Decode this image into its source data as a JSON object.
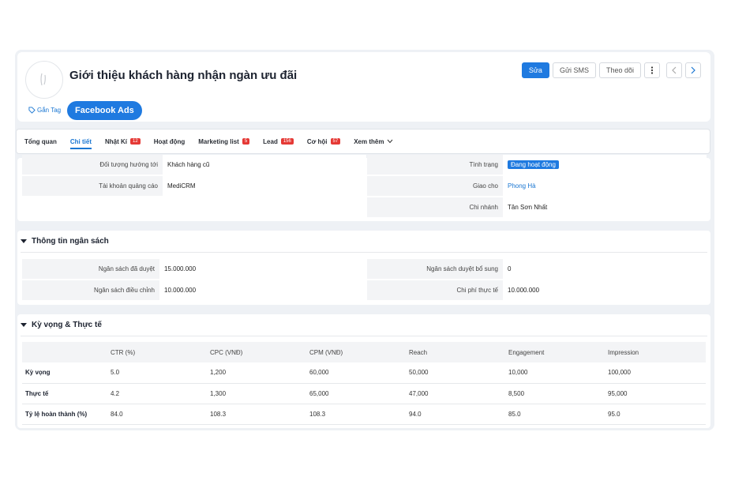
{
  "header": {
    "title": "Giới thiệu khách hàng nhận ngàn ưu đãi",
    "tag_label": "Gắn Tag",
    "channel_pill": "Facebook Ads",
    "actions": {
      "edit": "Sửa",
      "sms": "Gửi SMS",
      "follow": "Theo dõi"
    }
  },
  "tabs": [
    {
      "label": "Tổng quan"
    },
    {
      "label": "Chi tiết"
    },
    {
      "label": "Nhật Kí",
      "badge": "12"
    },
    {
      "label": "Hoạt động"
    },
    {
      "label": "Marketing list",
      "badge": "5"
    },
    {
      "label": "Lead",
      "badge": "156"
    },
    {
      "label": "Cơ hội",
      "badge": "57"
    },
    {
      "label": "Xem thêm"
    }
  ],
  "detail": {
    "left": [
      {
        "label": "Đối tượng hướng tới",
        "value": "Khách hàng cũ"
      },
      {
        "label": "Tài khoản quảng cáo",
        "value": "MediCRM"
      }
    ],
    "right": [
      {
        "label": "Tình trạng",
        "value": "Đang hoạt động"
      },
      {
        "label": "Giao cho",
        "value": "Phong Hà"
      },
      {
        "label": "Chi nhánh",
        "value": "Tân Sơn Nhất"
      }
    ]
  },
  "budget": {
    "title": "Thông tin ngân sách",
    "left": [
      {
        "label": "Ngân sách đã duyệt",
        "value": "15.000.000"
      },
      {
        "label": "Ngân sách điều chỉnh",
        "value": "10.000.000"
      }
    ],
    "right": [
      {
        "label": "Ngân sách duyệt bổ sung",
        "value": "0"
      },
      {
        "label": "Chi phí thực tế",
        "value": "10.000.000"
      }
    ]
  },
  "kpi": {
    "title": "Kỳ vọng & Thực tế",
    "columns": [
      "CTR (%)",
      "CPC (VNĐ)",
      "CPM (VNĐ)",
      "Reach",
      "Engagement",
      "Impression"
    ],
    "rows": [
      {
        "label": "Kỳ vọng",
        "values": [
          "5.0",
          "1,200",
          "60,000",
          "50,000",
          "10,000",
          "100,000"
        ]
      },
      {
        "label": "Thực tế",
        "values": [
          "4.2",
          "1,300",
          "65,000",
          "47,000",
          "8,500",
          "95,000"
        ]
      },
      {
        "label": "Tỷ lệ hoàn thành (%)",
        "values": [
          "84.0",
          "108.3",
          "108.3",
          "94.0",
          "85.0",
          "95.0"
        ]
      }
    ]
  },
  "colors": {
    "accent": "#1f7ae0",
    "badge": "#e53935"
  }
}
